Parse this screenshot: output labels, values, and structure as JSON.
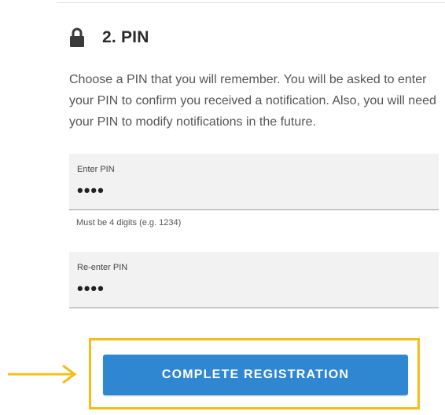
{
  "section": {
    "title": "2. PIN",
    "icon": "lock-icon",
    "description": "Choose a PIN that you will remember. You will be asked to enter your PIN to confirm you received a notification. Also, you will need your PIN to modify notifications in the future."
  },
  "fields": {
    "pin": {
      "label": "Enter PIN",
      "value": "••••",
      "helper": "Must be 4 digits (e.g. 1234)"
    },
    "confirm_pin": {
      "label": "Re-enter PIN",
      "value": "••••"
    }
  },
  "actions": {
    "complete_label": "COMPLETE REGISTRATION"
  },
  "colors": {
    "accent": "#2f86d1",
    "highlight": "#f4be18",
    "field_background": "#f2f2f2"
  }
}
